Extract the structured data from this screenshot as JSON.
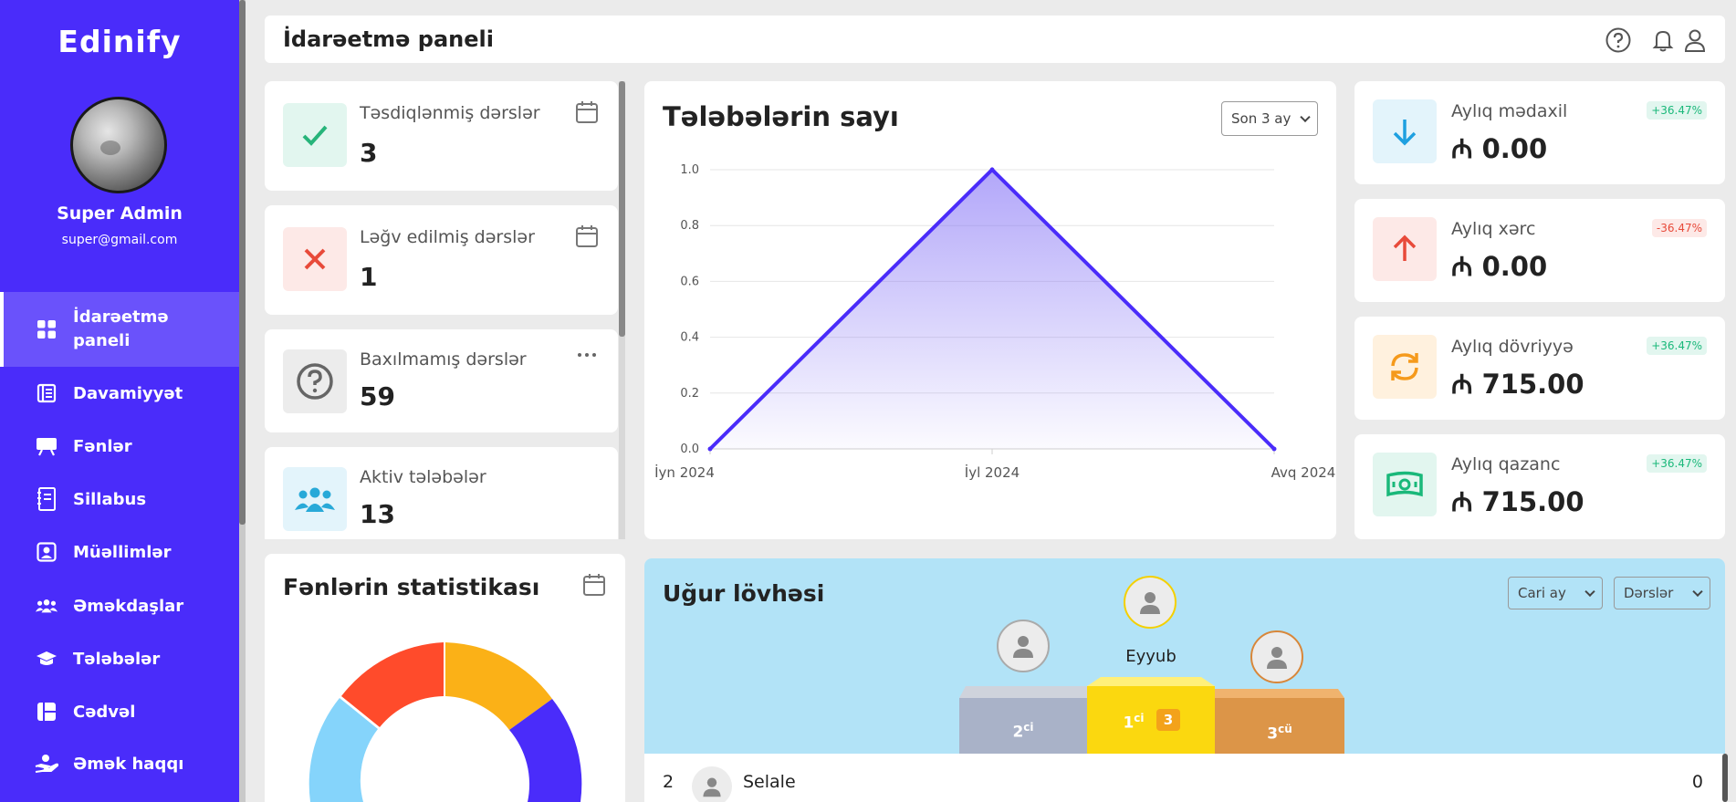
{
  "app": {
    "logo": "Edinify"
  },
  "user": {
    "name": "Super Admin",
    "email": "super@gmail.com"
  },
  "sidebar": {
    "items": [
      {
        "label": "İdarəetmə paneli",
        "icon": "dashboard-grid-icon",
        "active": true
      },
      {
        "label": "Davamiyyət",
        "icon": "attendance-book-icon"
      },
      {
        "label": "Fənlər",
        "icon": "subjects-board-icon"
      },
      {
        "label": "Sillabus",
        "icon": "syllabus-notebook-icon"
      },
      {
        "label": "Müəllimlər",
        "icon": "teacher-card-icon"
      },
      {
        "label": "Əməkdaşlar",
        "icon": "employees-group-icon"
      },
      {
        "label": "Tələbələr",
        "icon": "graduation-cap-icon"
      },
      {
        "label": "Cədvəl",
        "icon": "schedule-table-icon"
      },
      {
        "label": "Əmək haqqı",
        "icon": "salary-hand-icon"
      }
    ]
  },
  "header": {
    "title": "İdarəetmə paneli"
  },
  "stats": [
    {
      "label": "Təsdiqlənmiş dərslər",
      "value": "3",
      "icon": "check-icon",
      "color": "#27b47a",
      "bg": "#e2f6ef",
      "corner": "calendar-icon"
    },
    {
      "label": "Ləğv edilmiş dərslər",
      "value": "1",
      "icon": "cross-icon",
      "color": "#e84a3a",
      "bg": "#fde9e7",
      "corner": "calendar-icon"
    },
    {
      "label": "Baxılmamış dərslər",
      "value": "59",
      "icon": "question-icon",
      "color": "#666666",
      "bg": "#ececec",
      "corner": "more-dots-icon"
    },
    {
      "label": "Aktiv tələbələr",
      "value": "13",
      "icon": "students-group-icon",
      "color": "#28a9d8",
      "bg": "#e3f4fb",
      "corner": ""
    }
  ],
  "chart_widget": {
    "title": "Tələbələrin sayı",
    "period_select": "Son 3 ay"
  },
  "chart_data": {
    "type": "area",
    "categories": [
      "İyn 2024",
      "İyl 2024",
      "Avq 2024"
    ],
    "series": [
      {
        "values": [
          0,
          1,
          0
        ]
      }
    ],
    "yticks": [
      "0.0",
      "0.2",
      "0.4",
      "0.6",
      "0.8",
      "1.0"
    ],
    "ylim": [
      0,
      1
    ],
    "grid": true,
    "color": "#4a2cfa"
  },
  "finance": [
    {
      "label": "Aylıq mədaxil",
      "value": "₼ 0.00",
      "badge": "+36.47%",
      "positive": true,
      "icon": "arrow-down-icon",
      "color": "#1ea0e0",
      "bg": "#e3f4fb"
    },
    {
      "label": "Aylıq xərc",
      "value": "₼ 0.00",
      "badge": "-36.47%",
      "positive": false,
      "icon": "arrow-up-icon",
      "color": "#e84a3a",
      "bg": "#fde9e7"
    },
    {
      "label": "Aylıq dövriyyə",
      "value": "₼ 715.00",
      "badge": "+36.47%",
      "positive": true,
      "icon": "refresh-icon",
      "color": "#f59a1c",
      "bg": "#fff1de"
    },
    {
      "label": "Aylıq qazanc",
      "value": "₼ 715.00",
      "badge": "+36.47%",
      "positive": true,
      "icon": "money-icon",
      "color": "#1ab87a",
      "bg": "#e2f6ef"
    }
  ],
  "subjects": {
    "title": "Fənlərin statistikası"
  },
  "leaderboard": {
    "title": "Uğur lövhəsi",
    "month_select": "Cari ay",
    "type_select": "Dərslər",
    "first_name": "Eyyub",
    "first_score": "3",
    "places": [
      "2ci",
      "1ci",
      "3cü"
    ],
    "rows": [
      {
        "rank": "2",
        "name": "Selale",
        "score": "0"
      }
    ]
  }
}
